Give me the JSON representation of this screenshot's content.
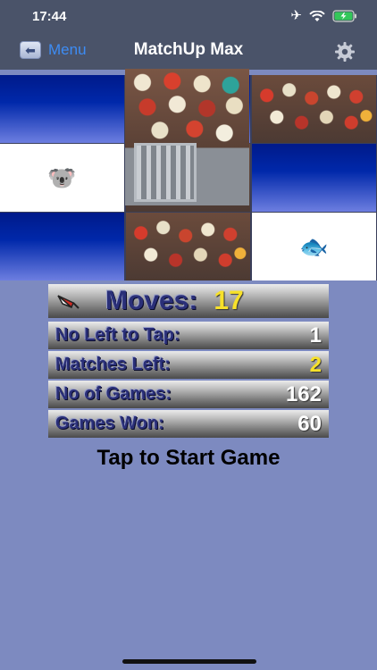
{
  "status": {
    "time": "17:44"
  },
  "nav": {
    "back_label": "Menu",
    "title": "MatchUp Max"
  },
  "grid": {
    "tiles": [
      {
        "state": "back"
      },
      {
        "state": "back"
      },
      {
        "state": "photo"
      },
      {
        "state": "emoji",
        "emoji": "🐨"
      },
      {
        "state": "photo"
      },
      {
        "state": "back"
      },
      {
        "state": "back"
      },
      {
        "state": "photo"
      },
      {
        "state": "emoji",
        "emoji": "🐟"
      }
    ]
  },
  "stats": {
    "moves_label": "Moves:",
    "moves_value": "17",
    "rows": [
      {
        "label": "No Left to Tap:",
        "value": "1"
      },
      {
        "label": "Matches Left:",
        "value": "2"
      },
      {
        "label": "No of Games:",
        "value": "162"
      },
      {
        "label": "Games Won:",
        "value": "60"
      }
    ]
  },
  "start_label": "Tap to Start Game",
  "colors": {
    "background": "#7d8ac0",
    "nav_bar": "#4a5369",
    "accent": "#3d8cf4",
    "highlight": "#f7e12a"
  }
}
